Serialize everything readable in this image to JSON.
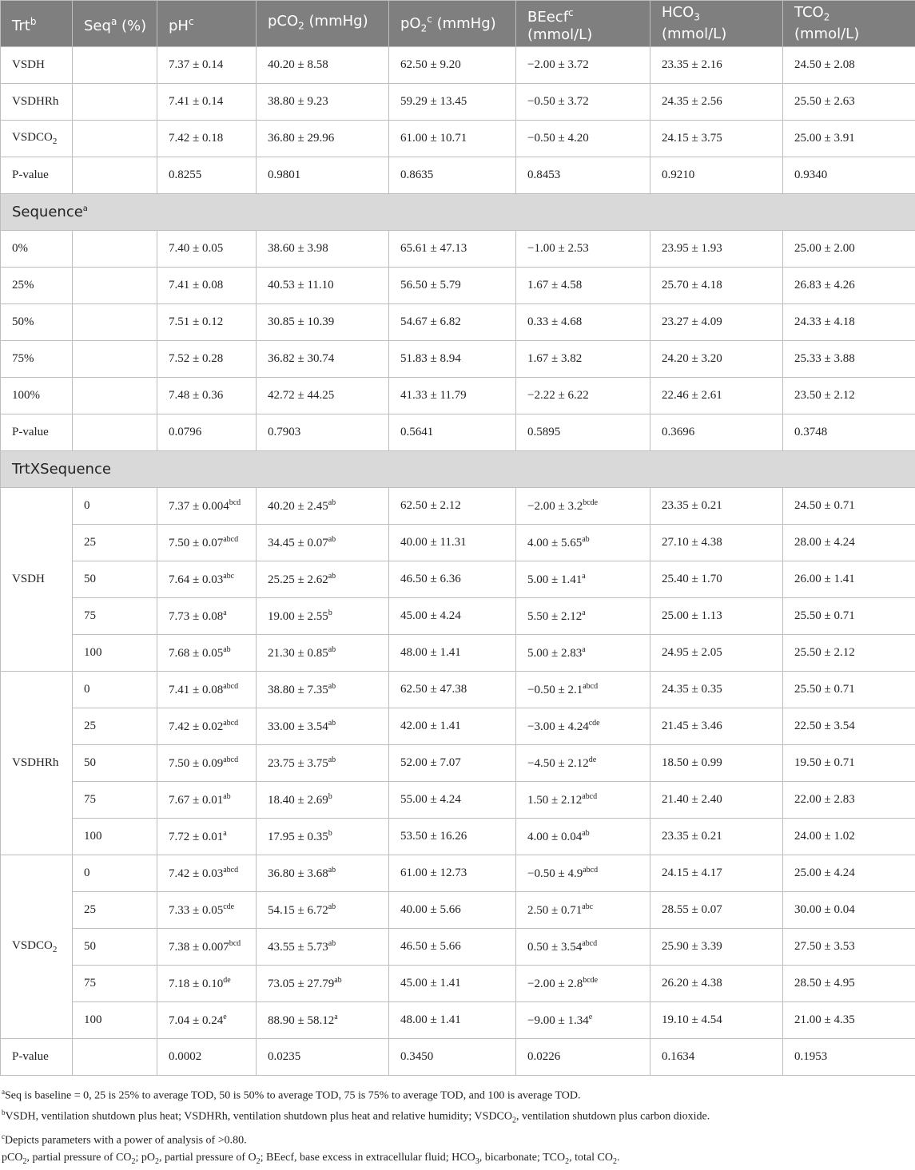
{
  "header": {
    "trt": "Trt",
    "trt_sup": "b",
    "seq": "Seq",
    "seq_sup": "a",
    "seq_unit": " (%)",
    "ph": "pH",
    "ph_sup": "c",
    "pco2_pre": "pCO",
    "pco2_sub": "2",
    "pco2_unit": " (mmHg)",
    "po2_pre": "pO",
    "po2_sub": "2",
    "po2_sup": "c",
    "po2_unit": " (mmHg)",
    "beecf": "BEecf",
    "beecf_sup": "c",
    "beecf_unit": "(mmol/L)",
    "hco3_pre": "HCO",
    "hco3_sub": "3",
    "hco3_unit": "(mmol/L)",
    "tco2_pre": "TCO",
    "tco2_sub": "2",
    "tco2_unit": "(mmol/L)"
  },
  "trt_rows": [
    {
      "name": "VSDH",
      "sub": "",
      "ph": "7.37 ± 0.14",
      "pco2": "40.20 ± 8.58",
      "po2": "62.50 ± 9.20",
      "beecf": "−2.00 ± 3.72",
      "hco3": "23.35 ± 2.16",
      "tco2": "24.50 ± 2.08"
    },
    {
      "name": "VSDHRh",
      "sub": "",
      "ph": "7.41 ± 0.14",
      "pco2": "38.80 ± 9.23",
      "po2": "59.29 ± 13.45",
      "beecf": "−0.50 ± 3.72",
      "hco3": "24.35 ± 2.56",
      "tco2": "25.50 ± 2.63"
    },
    {
      "name": "VSDCO",
      "sub": "2",
      "ph": "7.42 ± 0.18",
      "pco2": "36.80 ± 29.96",
      "po2": "61.00 ± 10.71",
      "beecf": "−0.50 ± 4.20",
      "hco3": "24.15 ± 3.75",
      "tco2": "25.00 ± 3.91"
    }
  ],
  "trt_pvalue": {
    "label": "P-value",
    "ph": "0.8255",
    "pco2": "0.9801",
    "po2": "0.8635",
    "beecf": "0.8453",
    "hco3": "0.9210",
    "tco2": "0.9340"
  },
  "sequence_section": {
    "label": "Sequence",
    "sup": "a"
  },
  "seq_rows": [
    {
      "name": "0%",
      "ph": "7.40 ± 0.05",
      "pco2": "38.60 ± 3.98",
      "po2": "65.61 ± 47.13",
      "beecf": "−1.00 ± 2.53",
      "hco3": "23.95 ± 1.93",
      "tco2": "25.00 ± 2.00"
    },
    {
      "name": "25%",
      "ph": "7.41 ± 0.08",
      "pco2": "40.53 ± 11.10",
      "po2": "56.50 ± 5.79",
      "beecf": "1.67 ± 4.58",
      "hco3": "25.70 ± 4.18",
      "tco2": "26.83 ± 4.26"
    },
    {
      "name": "50%",
      "ph": "7.51 ± 0.12",
      "pco2": "30.85 ± 10.39",
      "po2": "54.67 ± 6.82",
      "beecf": "0.33 ± 4.68",
      "hco3": "23.27 ± 4.09",
      "tco2": "24.33 ± 4.18"
    },
    {
      "name": "75%",
      "ph": "7.52 ± 0.28",
      "pco2": "36.82 ± 30.74",
      "po2": "51.83 ± 8.94",
      "beecf": "1.67 ± 3.82",
      "hco3": "24.20 ± 3.20",
      "tco2": "25.33 ± 3.88"
    },
    {
      "name": "100%",
      "ph": "7.48 ± 0.36",
      "pco2": "42.72 ± 44.25",
      "po2": "41.33 ± 11.79",
      "beecf": "−2.22 ± 6.22",
      "hco3": "22.46 ± 2.61",
      "tco2": "23.50 ± 2.12"
    }
  ],
  "seq_pvalue": {
    "label": "P-value",
    "ph": "0.0796",
    "pco2": "0.7903",
    "po2": "0.5641",
    "beecf": "0.5895",
    "hco3": "0.3696",
    "tco2": "0.3748"
  },
  "txs_section": {
    "label": "TrtXSequence"
  },
  "txs_groups": [
    {
      "name": "VSDH",
      "sub": "",
      "rows": [
        {
          "seq": "0",
          "ph": "7.37 ± 0.004",
          "ph_sup": "bcd",
          "pco2": "40.20 ± 2.45",
          "pco2_sup": "ab",
          "po2": "62.50 ± 2.12",
          "beecf": "−2.00 ± 3.2",
          "beecf_sup": "bcde",
          "hco3": "23.35 ± 0.21",
          "tco2": "24.50 ± 0.71"
        },
        {
          "seq": "25",
          "ph": "7.50 ± 0.07",
          "ph_sup": "abcd",
          "pco2": "34.45 ± 0.07",
          "pco2_sup": "ab",
          "po2": "40.00 ± 11.31",
          "beecf": "4.00 ± 5.65",
          "beecf_sup": "ab",
          "hco3": "27.10 ± 4.38",
          "tco2": "28.00 ± 4.24"
        },
        {
          "seq": "50",
          "ph": "7.64 ± 0.03",
          "ph_sup": "abc",
          "pco2": "25.25 ± 2.62",
          "pco2_sup": "ab",
          "po2": "46.50 ± 6.36",
          "beecf": "5.00 ± 1.41",
          "beecf_sup": "a",
          "hco3": "25.40 ± 1.70",
          "tco2": "26.00 ± 1.41"
        },
        {
          "seq": "75",
          "ph": "7.73 ± 0.08",
          "ph_sup": "a",
          "pco2": "19.00 ± 2.55",
          "pco2_sup": "b",
          "po2": "45.00 ± 4.24",
          "beecf": "5.50 ± 2.12",
          "beecf_sup": "a",
          "hco3": "25.00 ± 1.13",
          "tco2": "25.50 ± 0.71"
        },
        {
          "seq": "100",
          "ph": "7.68 ± 0.05",
          "ph_sup": "ab",
          "pco2": "21.30 ± 0.85",
          "pco2_sup": "ab",
          "po2": "48.00 ± 1.41",
          "beecf": "5.00 ± 2.83",
          "beecf_sup": "a",
          "hco3": "24.95 ± 2.05",
          "tco2": "25.50 ± 2.12"
        }
      ]
    },
    {
      "name": "VSDHRh",
      "sub": "",
      "rows": [
        {
          "seq": "0",
          "ph": "7.41 ± 0.08",
          "ph_sup": "abcd",
          "pco2": "38.80 ± 7.35",
          "pco2_sup": "ab",
          "po2": "62.50 ± 47.38",
          "beecf": "−0.50 ± 2.1",
          "beecf_sup": "abcd",
          "hco3": "24.35 ± 0.35",
          "tco2": "25.50 ± 0.71"
        },
        {
          "seq": "25",
          "ph": "7.42 ± 0.02",
          "ph_sup": "abcd",
          "pco2": "33.00 ± 3.54",
          "pco2_sup": "ab",
          "po2": "42.00 ± 1.41",
          "beecf": "−3.00 ± 4.24",
          "beecf_sup": "cde",
          "hco3": "21.45 ± 3.46",
          "tco2": "22.50 ± 3.54"
        },
        {
          "seq": "50",
          "ph": "7.50 ± 0.09",
          "ph_sup": "abcd",
          "pco2": "23.75 ± 3.75",
          "pco2_sup": "ab",
          "po2": "52.00 ± 7.07",
          "beecf": "−4.50 ± 2.12",
          "beecf_sup": "de",
          "hco3": "18.50 ± 0.99",
          "tco2": "19.50 ± 0.71"
        },
        {
          "seq": "75",
          "ph": "7.67 ± 0.01",
          "ph_sup": "ab",
          "pco2": "18.40 ± 2.69",
          "pco2_sup": "b",
          "po2": "55.00 ± 4.24",
          "beecf": "1.50 ± 2.12",
          "beecf_sup": "abcd",
          "hco3": "21.40 ± 2.40",
          "tco2": "22.00 ± 2.83"
        },
        {
          "seq": "100",
          "ph": "7.72 ± 0.01",
          "ph_sup": "a",
          "pco2": "17.95 ± 0.35",
          "pco2_sup": "b",
          "po2": "53.50 ± 16.26",
          "beecf": "4.00 ± 0.04",
          "beecf_sup": "ab",
          "hco3": "23.35 ± 0.21",
          "tco2": "24.00 ± 1.02"
        }
      ]
    },
    {
      "name": "VSDCO",
      "sub": "2",
      "rows": [
        {
          "seq": "0",
          "ph": "7.42 ± 0.03",
          "ph_sup": "abcd",
          "pco2": "36.80 ± 3.68",
          "pco2_sup": "ab",
          "po2": "61.00 ± 12.73",
          "beecf": "−0.50 ± 4.9",
          "beecf_sup": "abcd",
          "hco3": "24.15 ± 4.17",
          "tco2": "25.00 ± 4.24"
        },
        {
          "seq": "25",
          "ph": "7.33 ± 0.05",
          "ph_sup": "cde",
          "pco2": "54.15 ± 6.72",
          "pco2_sup": "ab",
          "po2": "40.00 ± 5.66",
          "beecf": "2.50 ± 0.71",
          "beecf_sup": "abc",
          "hco3": "28.55 ± 0.07",
          "tco2": "30.00 ± 0.04"
        },
        {
          "seq": "50",
          "ph": "7.38 ± 0.007",
          "ph_sup": "bcd",
          "pco2": "43.55 ± 5.73",
          "pco2_sup": "ab",
          "po2": "46.50 ± 5.66",
          "beecf": "0.50 ± 3.54",
          "beecf_sup": "abcd",
          "hco3": "25.90 ± 3.39",
          "tco2": "27.50 ± 3.53"
        },
        {
          "seq": "75",
          "ph": "7.18 ± 0.10",
          "ph_sup": "de",
          "pco2": "73.05 ± 27.79",
          "pco2_sup": "ab",
          "po2": "45.00 ± 1.41",
          "beecf": "−2.00 ± 2.8",
          "beecf_sup": "bcde",
          "hco3": "26.20 ± 4.38",
          "tco2": "28.50 ± 4.95"
        },
        {
          "seq": "100",
          "ph": "7.04 ± 0.24",
          "ph_sup": "e",
          "pco2": "88.90 ± 58.12",
          "pco2_sup": "a",
          "po2": "48.00 ± 1.41",
          "beecf": "−9.00 ± 1.34",
          "beecf_sup": "e",
          "hco3": "19.10 ± 4.54",
          "tco2": "21.00 ± 4.35"
        }
      ]
    }
  ],
  "txs_pvalue": {
    "label": "P-value",
    "ph": "0.0002",
    "pco2": "0.0235",
    "po2": "0.3450",
    "beecf": "0.0226",
    "hco3": "0.1634",
    "tco2": "0.1953"
  },
  "footnotes": {
    "a_sup": "a",
    "a": "Seq is baseline = 0, 25 is 25% to average TOD, 50 is 50% to average TOD, 75 is 75% to average TOD, and 100 is average TOD.",
    "b_sup": "b",
    "b_pre": "VSDH, ventilation shutdown plus heat; VSDHRh, ventilation shutdown plus heat and relative humidity; VSDCO",
    "b_sub": "2",
    "b_post": ", ventilation shutdown plus carbon dioxide.",
    "c_sup": "c",
    "c": "Depicts parameters with a power of analysis of >0.80.",
    "d": [
      {
        "t": "pCO"
      },
      {
        "sub": "2"
      },
      {
        "t": ", partial pressure of CO"
      },
      {
        "sub": "2"
      },
      {
        "t": "; pO"
      },
      {
        "sub": "2"
      },
      {
        "t": ", partial pressure of O"
      },
      {
        "sub": "2"
      },
      {
        "t": "; BEecf, base excess in extracellular fluid; HCO"
      },
      {
        "sub": "3"
      },
      {
        "t": ", bicarbonate; TCO"
      },
      {
        "sub": "2"
      },
      {
        "t": ", total CO"
      },
      {
        "sub": "2"
      },
      {
        "t": "."
      }
    ]
  }
}
